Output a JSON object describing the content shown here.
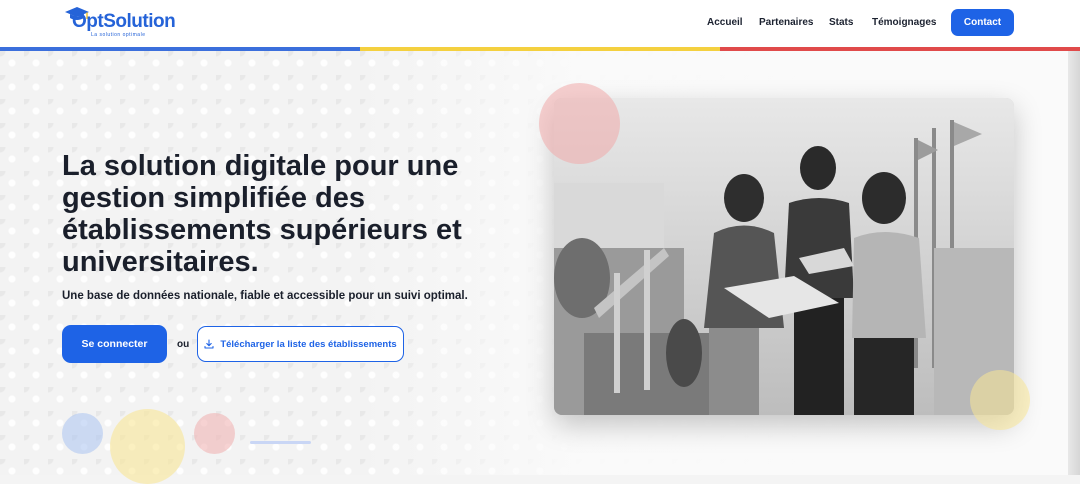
{
  "header": {
    "logo": {
      "name": "OptSolution",
      "tagline": "La solution optimale"
    },
    "nav": [
      "Accueil",
      "Partenaires",
      "Stats",
      "Témoignages"
    ],
    "contact_label": "Contact",
    "brand_colors": [
      "#3b6fdc",
      "#f4d03f",
      "#e04a4a"
    ]
  },
  "hero": {
    "title": "La solution digitale pour une gestion simplifiée des établissements supérieurs et universitaires.",
    "subtitle": "Une base de données nationale, fiable et accessible pour un suivi optimal.",
    "login_label": "Se connecter",
    "or_label": "ou",
    "download_label": "Télécharger la liste des établissements",
    "download_icon": "download-icon",
    "accent": "#1e63e6"
  }
}
